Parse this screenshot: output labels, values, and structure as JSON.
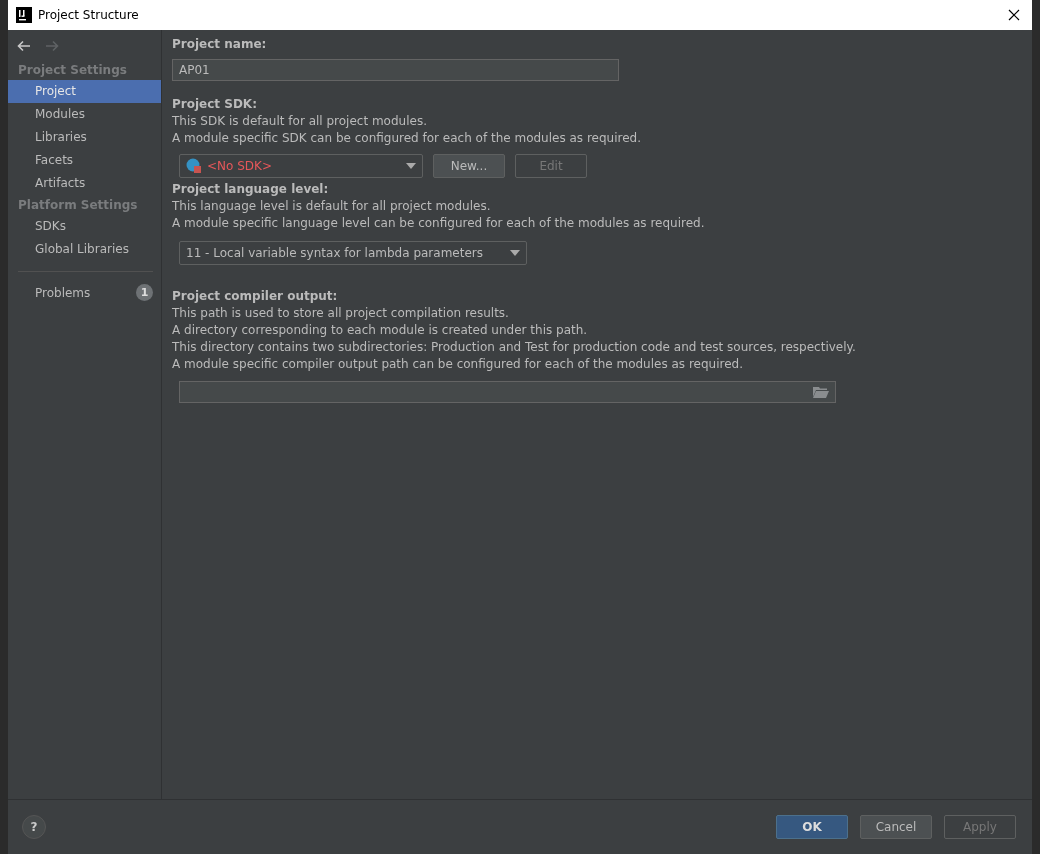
{
  "window": {
    "title": "Project Structure"
  },
  "sidebar": {
    "groups": [
      {
        "heading": "Project Settings",
        "items": [
          {
            "label": "Project",
            "selected": true
          },
          {
            "label": "Modules",
            "selected": false
          },
          {
            "label": "Libraries",
            "selected": false
          },
          {
            "label": "Facets",
            "selected": false
          },
          {
            "label": "Artifacts",
            "selected": false
          }
        ]
      },
      {
        "heading": "Platform Settings",
        "items": [
          {
            "label": "SDKs",
            "selected": false
          },
          {
            "label": "Global Libraries",
            "selected": false
          }
        ]
      }
    ],
    "problems": {
      "label": "Problems",
      "count": "1"
    }
  },
  "project_name": {
    "label": "Project name:",
    "value": "AP01"
  },
  "project_sdk": {
    "label": "Project SDK:",
    "description": [
      "This SDK is default for all project modules.",
      "A module specific SDK can be configured for each of the modules as required."
    ],
    "dropdown": "<No SDK>",
    "buttons": [
      {
        "label": "New...",
        "disabled": false
      },
      {
        "label": "Edit",
        "disabled": true
      }
    ]
  },
  "language_level": {
    "label": "Project language level:",
    "description": [
      "This language level is default for all project modules.",
      "A module specific language level can be configured for each of the modules as required."
    ],
    "dropdown": "11 - Local variable syntax for lambda parameters"
  },
  "compiler_output": {
    "label": "Project compiler output:",
    "description": [
      "This path is used to store all project compilation results.",
      "A directory corresponding to each module is created under this path.",
      "This directory contains two subdirectories: Production and Test for production code and test sources, respectively.",
      "A module specific compiler output path can be configured for each of the modules as required."
    ]
  },
  "footer": {
    "help": "?",
    "buttons": [
      {
        "label": "OK",
        "kind": "default",
        "disabled": false
      },
      {
        "label": "Cancel",
        "kind": "normal",
        "disabled": false
      },
      {
        "label": "Apply",
        "kind": "normal",
        "disabled": true
      }
    ]
  }
}
